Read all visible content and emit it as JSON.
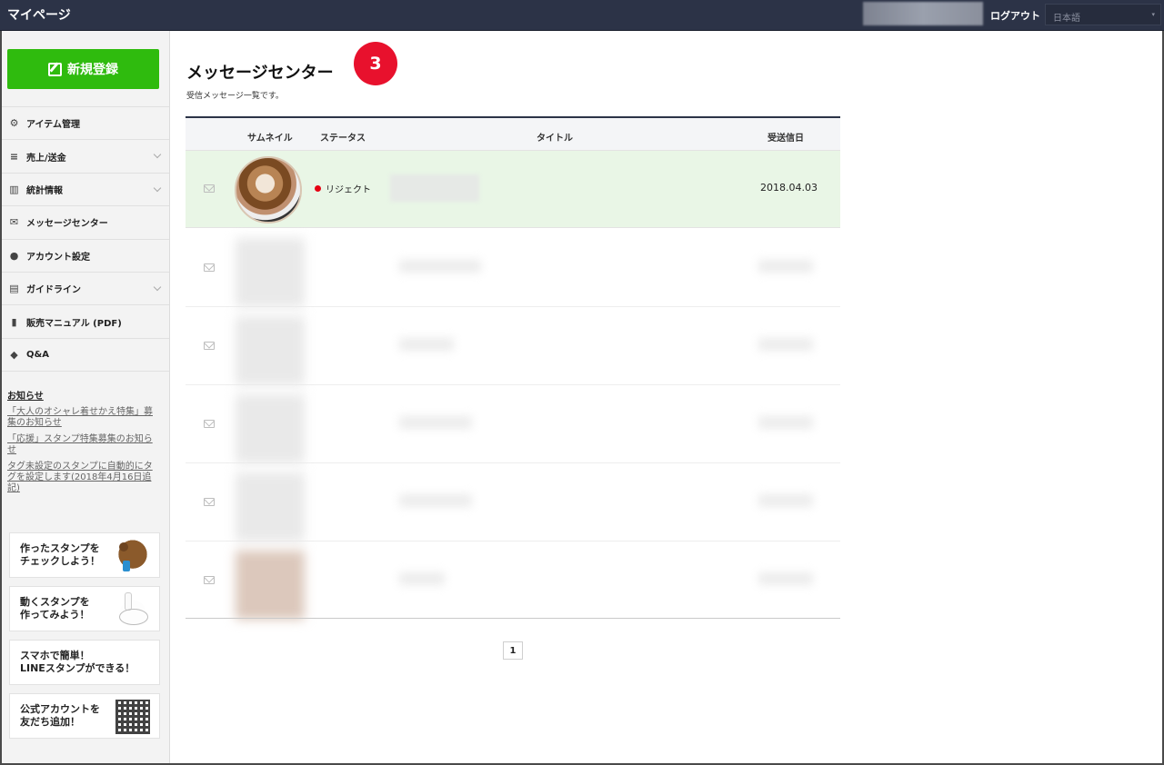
{
  "header": {
    "app_title": "マイページ",
    "logout_label": "ログアウト",
    "language": "日本語"
  },
  "sidebar": {
    "new_button_label": "新規登録",
    "items": [
      {
        "label": "アイテム管理",
        "icon": "gear-icon",
        "has_submenu": false
      },
      {
        "label": "売上/送金",
        "icon": "database-icon",
        "has_submenu": true
      },
      {
        "label": "統計情報",
        "icon": "bar-chart-icon",
        "has_submenu": true
      },
      {
        "label": "メッセージセンター",
        "icon": "envelope-icon",
        "has_submenu": false
      },
      {
        "label": "アカウント設定",
        "icon": "person-icon",
        "has_submenu": false
      },
      {
        "label": "ガイドライン",
        "icon": "document-icon",
        "has_submenu": true
      },
      {
        "label": "販売マニュアル (PDF)",
        "icon": "file-icon",
        "has_submenu": false
      },
      {
        "label": "Q&A",
        "icon": "speech-bubble-icon",
        "has_submenu": false
      }
    ],
    "news": {
      "heading": "お知らせ",
      "links": [
        "「大人のオシャレ着せかえ特集」募集のお知らせ",
        "「応援」スタンプ特集募集のお知らせ",
        "タグ未設定のスタンプに自動的にタグを設定します(2018年4月16日追記)"
      ]
    },
    "banners": [
      {
        "line1": "作ったスタンプを",
        "line2": "チェックしよう！",
        "icon": "bear-character-icon"
      },
      {
        "line1": "動くスタンプを",
        "line2": "作ってみよう！",
        "icon": "rabbit-character-icon"
      },
      {
        "line1": "スマホで簡単！",
        "line2": "LINEスタンプができる！",
        "icon": ""
      },
      {
        "line1": "公式アカウントを",
        "line2": "友だち追加！",
        "icon": "qr-code-icon"
      }
    ]
  },
  "main": {
    "title": "メッセージセンター",
    "subtitle": "受信メッセージ一覧です。",
    "columns": [
      "サムネイル",
      "ステータス",
      "タイトル",
      "受送信日"
    ],
    "rows": [
      {
        "status": "リジェクト",
        "status_color": "#e60012",
        "date": "2018.04.03",
        "badge": "3"
      }
    ],
    "pagination": {
      "current": "1"
    }
  },
  "colors": {
    "topbar": "#2c3347",
    "primary_green": "#2fbb0e",
    "highlight_row": "#e9f6e6",
    "badge_red": "#e8112d"
  }
}
